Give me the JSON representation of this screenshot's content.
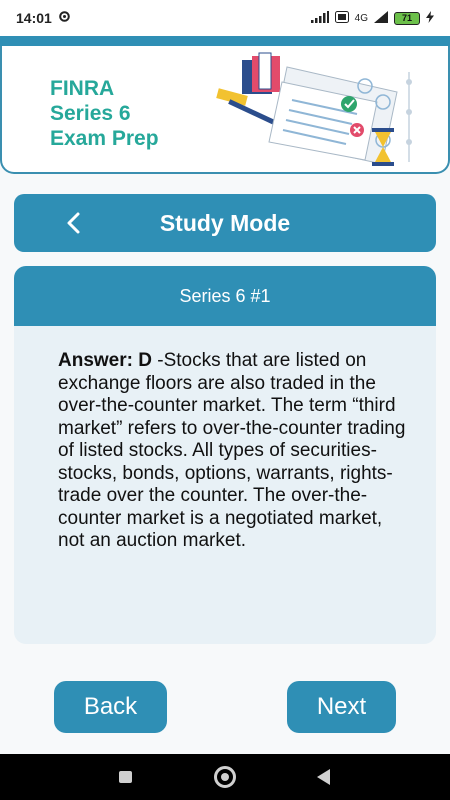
{
  "status_bar": {
    "time": "14:01",
    "battery": "71",
    "network": "4G",
    "icons": [
      "settings-icon",
      "signal-icon",
      "volte-icon",
      "battery-icon",
      "charging-icon"
    ]
  },
  "banner": {
    "title_line1": "FINRA",
    "title_line2": "Series 6",
    "title_line3": "Exam Prep"
  },
  "header": {
    "back_icon": "chevron-left-icon",
    "title": "Study Mode"
  },
  "card": {
    "title": "Series 6 #1",
    "answer_label": "Answer: D",
    "answer_text": " -Stocks that are listed on exchange floors are also traded in the over-the-counter market. The term “third market” refers to over-the-counter trading of listed stocks. All types of securities-stocks, bonds, options, warrants, rights-trade over the counter. The over-the-counter market is a negotiated market, not an auction market."
  },
  "buttons": {
    "back_label": "Back",
    "next_label": "Next"
  },
  "colors": {
    "primary": "#2f8fb5",
    "banner_title": "#26a89a",
    "card_bg": "#e8f1f6"
  }
}
